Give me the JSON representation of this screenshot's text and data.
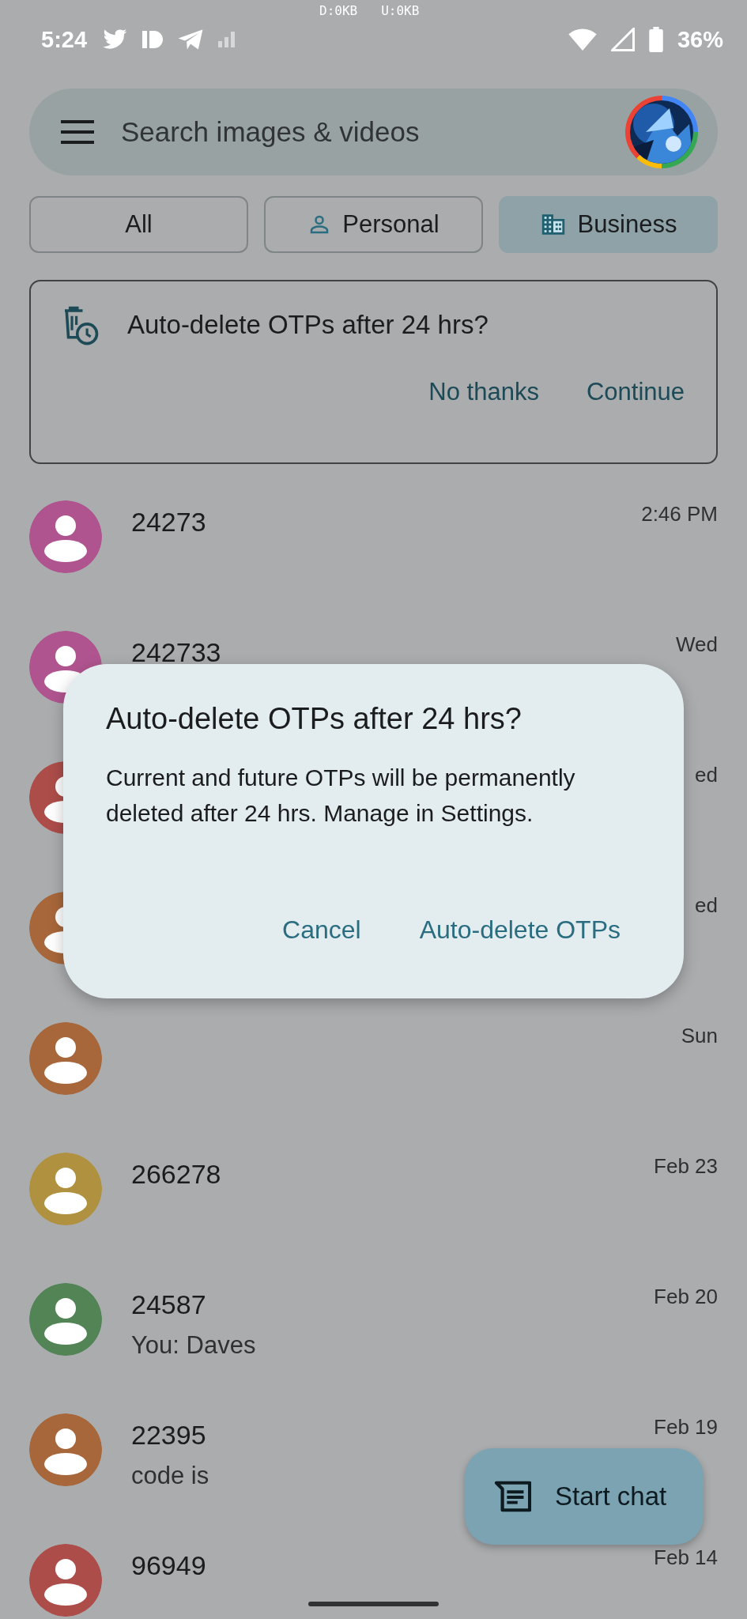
{
  "status_bar": {
    "time": "5:24",
    "traffic_down": "D:0KB",
    "traffic_up": "U:0KB",
    "battery": "36%"
  },
  "search": {
    "placeholder": "Search images & videos"
  },
  "tabs": [
    {
      "label": "All",
      "kind": "plain",
      "selected": false
    },
    {
      "label": "Personal",
      "kind": "personal",
      "selected": false
    },
    {
      "label": "Business",
      "kind": "business",
      "selected": true
    }
  ],
  "banner": {
    "title": "Auto-delete OTPs after 24 hrs?",
    "actions": [
      "No thanks",
      "Continue"
    ]
  },
  "conversations": [
    {
      "name": "24273",
      "time": "2:46 PM",
      "color": "#b0548f"
    },
    {
      "name": "242733",
      "time": "Wed",
      "color": "#b0548f"
    },
    {
      "time": "ed",
      "color": "#ad4d4a"
    },
    {
      "time": "ed",
      "color": "#a8673a"
    },
    {
      "time": "Sun",
      "color": "#a8673a"
    },
    {
      "name": "266278",
      "time": "Feb 23",
      "color": "#b0913f"
    },
    {
      "name": "24587",
      "time": "Feb 20",
      "snippet": "You: Daves",
      "color": "#528456"
    },
    {
      "name": "22395",
      "time": "Feb 19",
      "snippet": "code is",
      "color": "#a8673a"
    },
    {
      "name": "96949",
      "time": "Feb 14",
      "color": "#ad4d4a"
    }
  ],
  "fab": {
    "label": "Start chat"
  },
  "dialog": {
    "title": "Auto-delete OTPs after 24 hrs?",
    "body": "Current and future OTPs will be permanently deleted after 24 hrs. Manage in Settings.",
    "buttons": [
      "Cancel",
      "Auto-delete OTPs"
    ]
  }
}
